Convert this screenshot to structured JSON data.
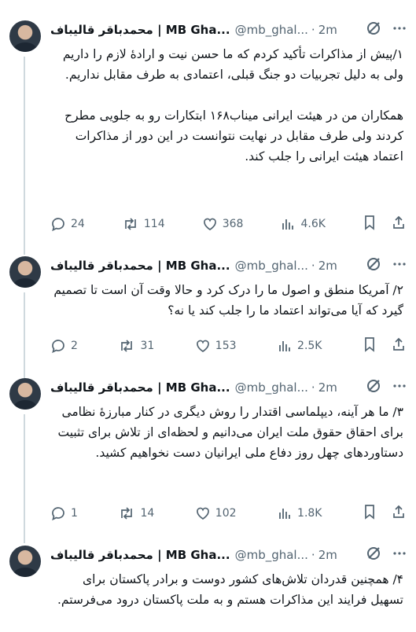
{
  "tweets": [
    {
      "name": "محمدباقر قالیباف | MB Gha...",
      "handle": "@mb_ghal...",
      "time": "2m",
      "paragraphs": [
        "۱/پیش از مذاکرات تأکید کردم که ما حسن نیت و ارادهٔ لازم را داریم ولی به دلیل تجربیات دو جنگ قبلی، اعتمادی به طرف مقابل نداریم.",
        "همکاران من در هیئت ایرانی میناب۱۶۸ ابتکارات رو به جلویی مطرح کردند ولی طرف مقابل در نهایت نتوانست در این دور از مذاکرات اعتماد هیئت ایرانی را جلب کند."
      ],
      "replies": "24",
      "reposts": "114",
      "likes": "368",
      "views": "4.6K"
    },
    {
      "name": "محمدباقر قالیباف | MB Gha...",
      "handle": "@mb_ghal...",
      "time": "2m",
      "paragraphs": [
        "۲/ آمریکا منطق و اصول ما را درک کرد و حالا وقت آن است تا تصمیم گیرد که آیا می‌تواند اعتماد ما را جلب کند یا نه؟"
      ],
      "replies": "2",
      "reposts": "31",
      "likes": "153",
      "views": "2.5K"
    },
    {
      "name": "محمدباقر قالیباف | MB Gha...",
      "handle": "@mb_ghal...",
      "time": "2m",
      "paragraphs": [
        "۳/ ما هر آینه، دیپلماسی اقتدار را روش دیگری در کنار مبارزهٔ نظامی برای احقاق حقوق ملت ایران می‌دانیم و لحظه‌ای از تلاش برای تثبیت دستاوردهای چهل روز دفاع ملی ایرانیان دست نخواهیم کشید."
      ],
      "replies": "1",
      "reposts": "14",
      "likes": "102",
      "views": "1.8K"
    },
    {
      "name": "محمدباقر قالیباف | MB Gha...",
      "handle": "@mb_ghal...",
      "time": "2m",
      "paragraphs": [
        "۴/ همچنین قدردان تلاش‌های کشور دوست و برادر پاکستان برای تسهیل فرایند این مذاکرات هستم و به ملت پاکستان درود می‌فرستم."
      ]
    }
  ],
  "icons": {
    "grok": "grok-slash-icon",
    "more": "more-dots-icon",
    "reply": "reply-bubble-icon",
    "repost": "repost-arrows-icon",
    "like": "heart-icon",
    "views": "views-bars-icon",
    "bookmark": "bookmark-icon",
    "share": "share-upload-icon"
  },
  "colors": {
    "text": "#0f1419",
    "muted": "#536471",
    "thread": "#cfd9de"
  }
}
